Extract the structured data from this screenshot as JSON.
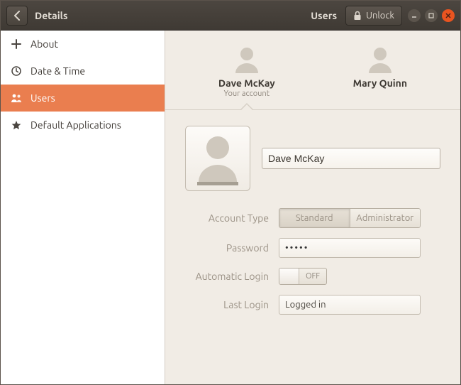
{
  "titlebar": {
    "title": "Details",
    "section": "Users",
    "unlock_label": "Unlock"
  },
  "sidebar": {
    "items": [
      {
        "label": "About",
        "icon": "plus"
      },
      {
        "label": "Date & Time",
        "icon": "clock"
      },
      {
        "label": "Users",
        "icon": "users",
        "selected": true
      },
      {
        "label": "Default Applications",
        "icon": "star"
      }
    ]
  },
  "users": [
    {
      "name": "Dave McKay",
      "subtitle": "Your account",
      "selected": true
    },
    {
      "name": "Mary Quinn",
      "subtitle": "",
      "selected": false
    }
  ],
  "form": {
    "full_name": "Dave McKay",
    "account_type": {
      "label": "Account Type",
      "options": [
        "Standard",
        "Administrator"
      ],
      "selected": "Standard"
    },
    "password": {
      "label": "Password",
      "masked": "•••••"
    },
    "automatic_login": {
      "label": "Automatic Login",
      "state": "OFF"
    },
    "last_login": {
      "label": "Last Login",
      "value": "Logged in"
    }
  }
}
